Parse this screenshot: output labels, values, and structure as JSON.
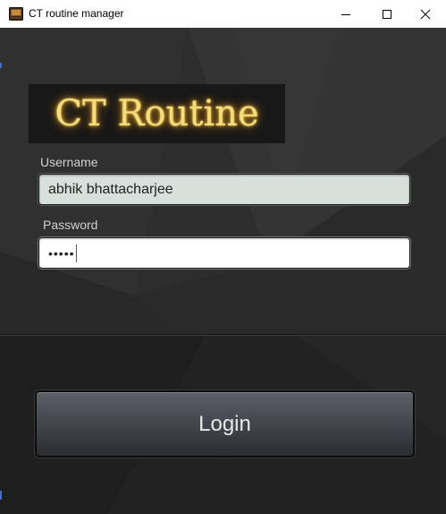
{
  "window": {
    "title": "CT routine manager",
    "icon": "app-icon",
    "controls": {
      "minimize_icon": "minimize-icon",
      "maximize_icon": "maximize-icon",
      "close_icon": "close-icon"
    }
  },
  "logo": {
    "text": "CT Routine"
  },
  "form": {
    "username_label": "Username",
    "username_value": "abhik bhattacharjee",
    "password_label": "Password",
    "password_masked": "•••••"
  },
  "login_button": {
    "label": "Login"
  },
  "colors": {
    "background": "#2e2e2e",
    "logo_glow": "#f3dd7c",
    "username_field_bg": "#d8e0dc",
    "button_top": "#5b6068",
    "button_bottom": "#2a2c30"
  }
}
